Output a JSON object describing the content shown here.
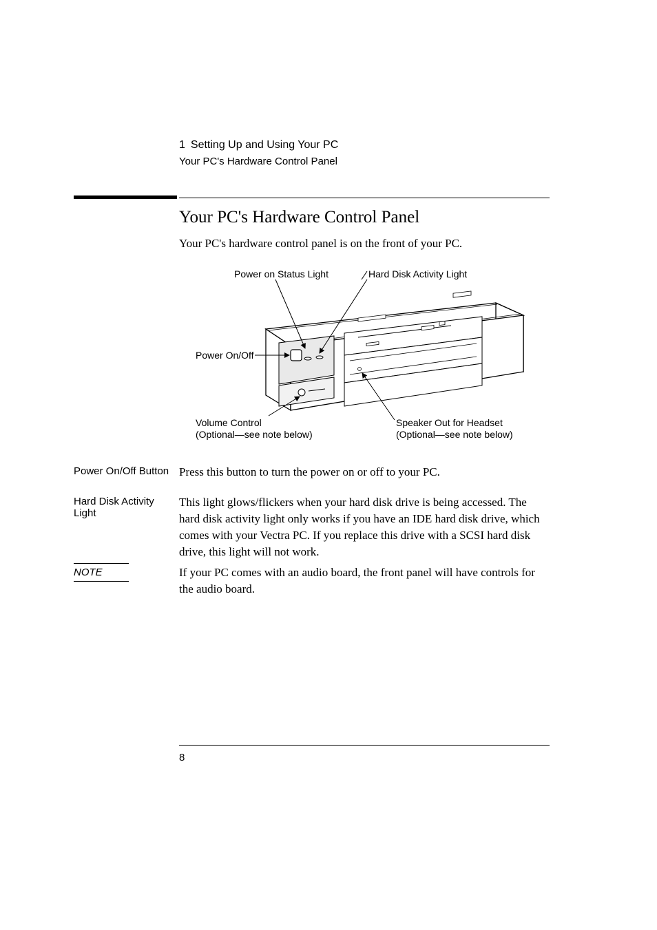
{
  "header": {
    "chapter_number": "1",
    "chapter_title": "Setting Up and Using Your PC",
    "subsection": "Your PC's Hardware Control Panel"
  },
  "title": "Your PC's Hardware Control Panel",
  "intro": "Your PC's hardware control panel is on the front of your PC.",
  "diagram": {
    "labels": {
      "power_status": "Power on Status Light",
      "hdd_light": "Hard Disk Activity Light",
      "power_onoff": "Power On/Off",
      "volume_l1": "Volume Control",
      "volume_l2": "(Optional—see note below)",
      "speaker_l1": "Speaker Out for Headset",
      "speaker_l2": "(Optional—see note below)"
    }
  },
  "definitions": [
    {
      "term": "Power On/Off Button",
      "body": "Press this button to turn the power on or off to your PC."
    },
    {
      "term": "Hard Disk Activity Light",
      "body": "This light glows/flickers when your hard disk drive is being accessed. The hard disk activity light only works if you have an IDE hard disk drive, which comes with your Vectra PC. If you replace this drive with a SCSI hard disk drive, this light will not work."
    }
  ],
  "note": {
    "label": "NOTE",
    "body": "If your PC comes with an audio board, the front panel will have controls for the audio board."
  },
  "footer": {
    "page_number": "8"
  }
}
